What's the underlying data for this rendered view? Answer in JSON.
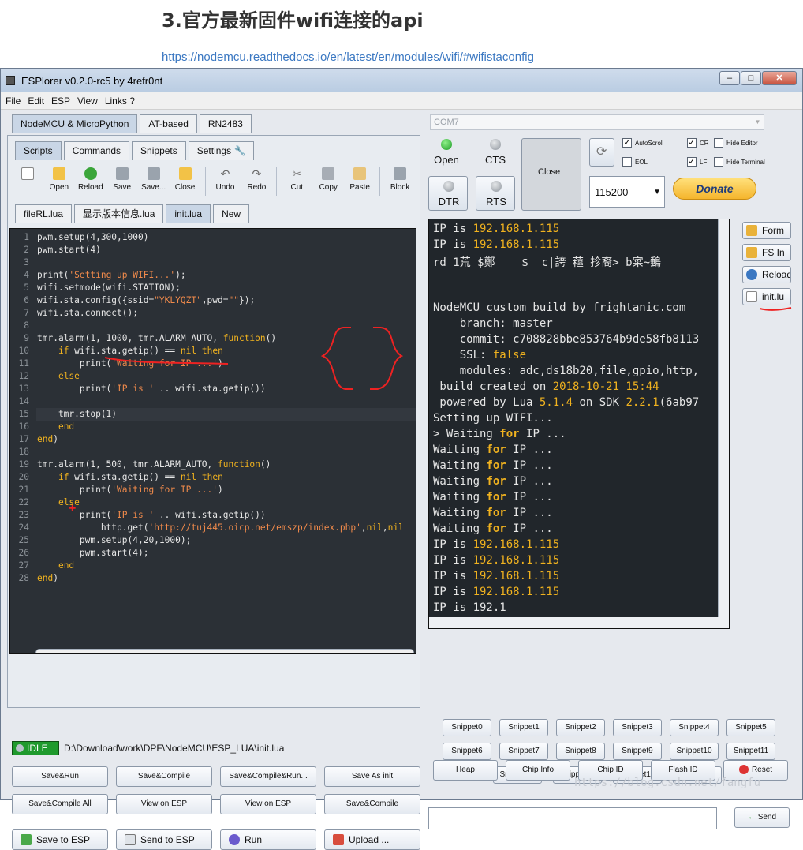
{
  "article": {
    "title": "3.官方最新固件wifi连接的api",
    "link": "https://nodemcu.readthedocs.io/en/latest/en/modules/wifi/#wifistaconfig"
  },
  "window": {
    "title": "ESPlorer v0.2.0-rc5 by 4refr0nt",
    "menu": [
      "File",
      "Edit",
      "ESP",
      "View",
      "Links ?"
    ]
  },
  "left": {
    "top_tabs": [
      "NodeMCU & MicroPython",
      "AT-based",
      "RN2483"
    ],
    "sub_tabs": [
      "Scripts",
      "Commands",
      "Snippets",
      "Settings"
    ],
    "toolbar": [
      "Open",
      "Reload",
      "Save",
      "Save...",
      "Close",
      "Undo",
      "Redo",
      "Cut",
      "Copy",
      "Paste",
      "Block"
    ],
    "file_tabs": [
      "fileRL.lua",
      "显示版本信息.lua",
      "init.lua",
      "New"
    ],
    "status": "IDLE",
    "path": "D:\\Download\\work\\DPF\\NodeMCU\\ESP_LUA\\init.lua",
    "buttons_row1": [
      "Save&Run",
      "Save&Compile",
      "Save&Compile&Run...",
      "Save As init"
    ],
    "buttons_row2": [
      "Save&Compile All",
      "View on ESP",
      "View on ESP",
      "Save&Compile"
    ],
    "buttons_row3": [
      "Save to ESP",
      "Send to ESP",
      "Run",
      "Upload ..."
    ]
  },
  "code_lines": [
    "pwm.setup(4,300,1000)",
    "pwm.start(4)",
    "",
    "print('Setting up WIFI...');",
    "wifi.setmode(wifi.STATION);",
    "wifi.sta.config({ssid=\"YKLYQZT\",pwd=\"\"});",
    "wifi.sta.connect();",
    "",
    "tmr.alarm(1, 1000, tmr.ALARM_AUTO, function()",
    "    if wifi.sta.getip() == nil then",
    "        print('Waiting for IP ...')",
    "    else",
    "        print('IP is ' .. wifi.sta.getip())",
    "",
    "    tmr.stop(1)",
    "    end",
    "end)",
    "",
    "tmr.alarm(1, 500, tmr.ALARM_AUTO, function()",
    "    if wifi.sta.getip() == nil then",
    "        print('Waiting for IP ...')",
    "    else",
    "        print('IP is ' .. wifi.sta.getip())",
    "            http.get('http://tuj445.oicp.net/emszp/index.php',nil,nil",
    "        pwm.setup(4,20,1000);",
    "        pwm.start(4);",
    "    end",
    "end)"
  ],
  "right": {
    "com_port": "COM7",
    "open_label": "Open",
    "cts_label": "CTS",
    "dtr_label": "DTR",
    "rts_label": "RTS",
    "close_label": "Close",
    "baud": "115200",
    "donate": "Donate",
    "checkboxes": [
      {
        "label": "AutoScroll",
        "checked": true
      },
      {
        "label": "CR",
        "checked": true
      },
      {
        "label": "Hide Editor",
        "checked": false
      },
      {
        "label": "EOL",
        "checked": false
      },
      {
        "label": "LF",
        "checked": true
      },
      {
        "label": "Hide Terminal",
        "checked": false
      }
    ],
    "side_buttons": [
      "Form",
      "FS In",
      "Reload",
      "init.lu"
    ],
    "snippets": [
      "Snippet0",
      "Snippet1",
      "Snippet2",
      "Snippet3",
      "Snippet4",
      "Snippet5",
      "Snippet6",
      "Snippet7",
      "Snippet8",
      "Snippet9",
      "Snippet10",
      "Snippet11",
      "Snippet12",
      "Snippet13",
      "Snippet14",
      "Snippet15"
    ],
    "bottom_buttons": [
      "Heap",
      "Chip Info",
      "Chip ID",
      "Flash ID",
      "Reset"
    ],
    "send": "Send"
  },
  "terminal_lines": [
    "IP is 192.168.1.115",
    "IP is 192.168.1.115",
    "rd 1荒 $鄭    $  c|誇 藲 抮裔> b寀~䳠",
    "",
    "",
    "NodeMCU custom build by frightanic.com",
    "    branch: master",
    "    commit: c708828bbe853764b9de58fb8113",
    "    SSL: false",
    "    modules: adc,ds18b20,file,gpio,http,",
    " build created on 2018-10-21 15:44",
    " powered by Lua 5.1.4 on SDK 2.2.1(6ab97",
    "Setting up WIFI...",
    "> Waiting for IP ...",
    "Waiting for IP ...",
    "Waiting for IP ...",
    "Waiting for IP ...",
    "Waiting for IP ...",
    "Waiting for IP ...",
    "Waiting for IP ...",
    "IP is 192.168.1.115",
    "IP is 192.168.1.115",
    "IP is 192.168.1.115",
    "IP is 192.168.1.115",
    "IP is 192.1"
  ],
  "watermark": "https://blog.csdn.net/fangfu",
  "colors": {
    "accent": "#c9d6e6",
    "editor_bg": "#2b3036",
    "terminal_bg": "#21262b",
    "keyword": "#f0b21f",
    "string": "#f08a4b",
    "idle": "#1f9a2d"
  }
}
